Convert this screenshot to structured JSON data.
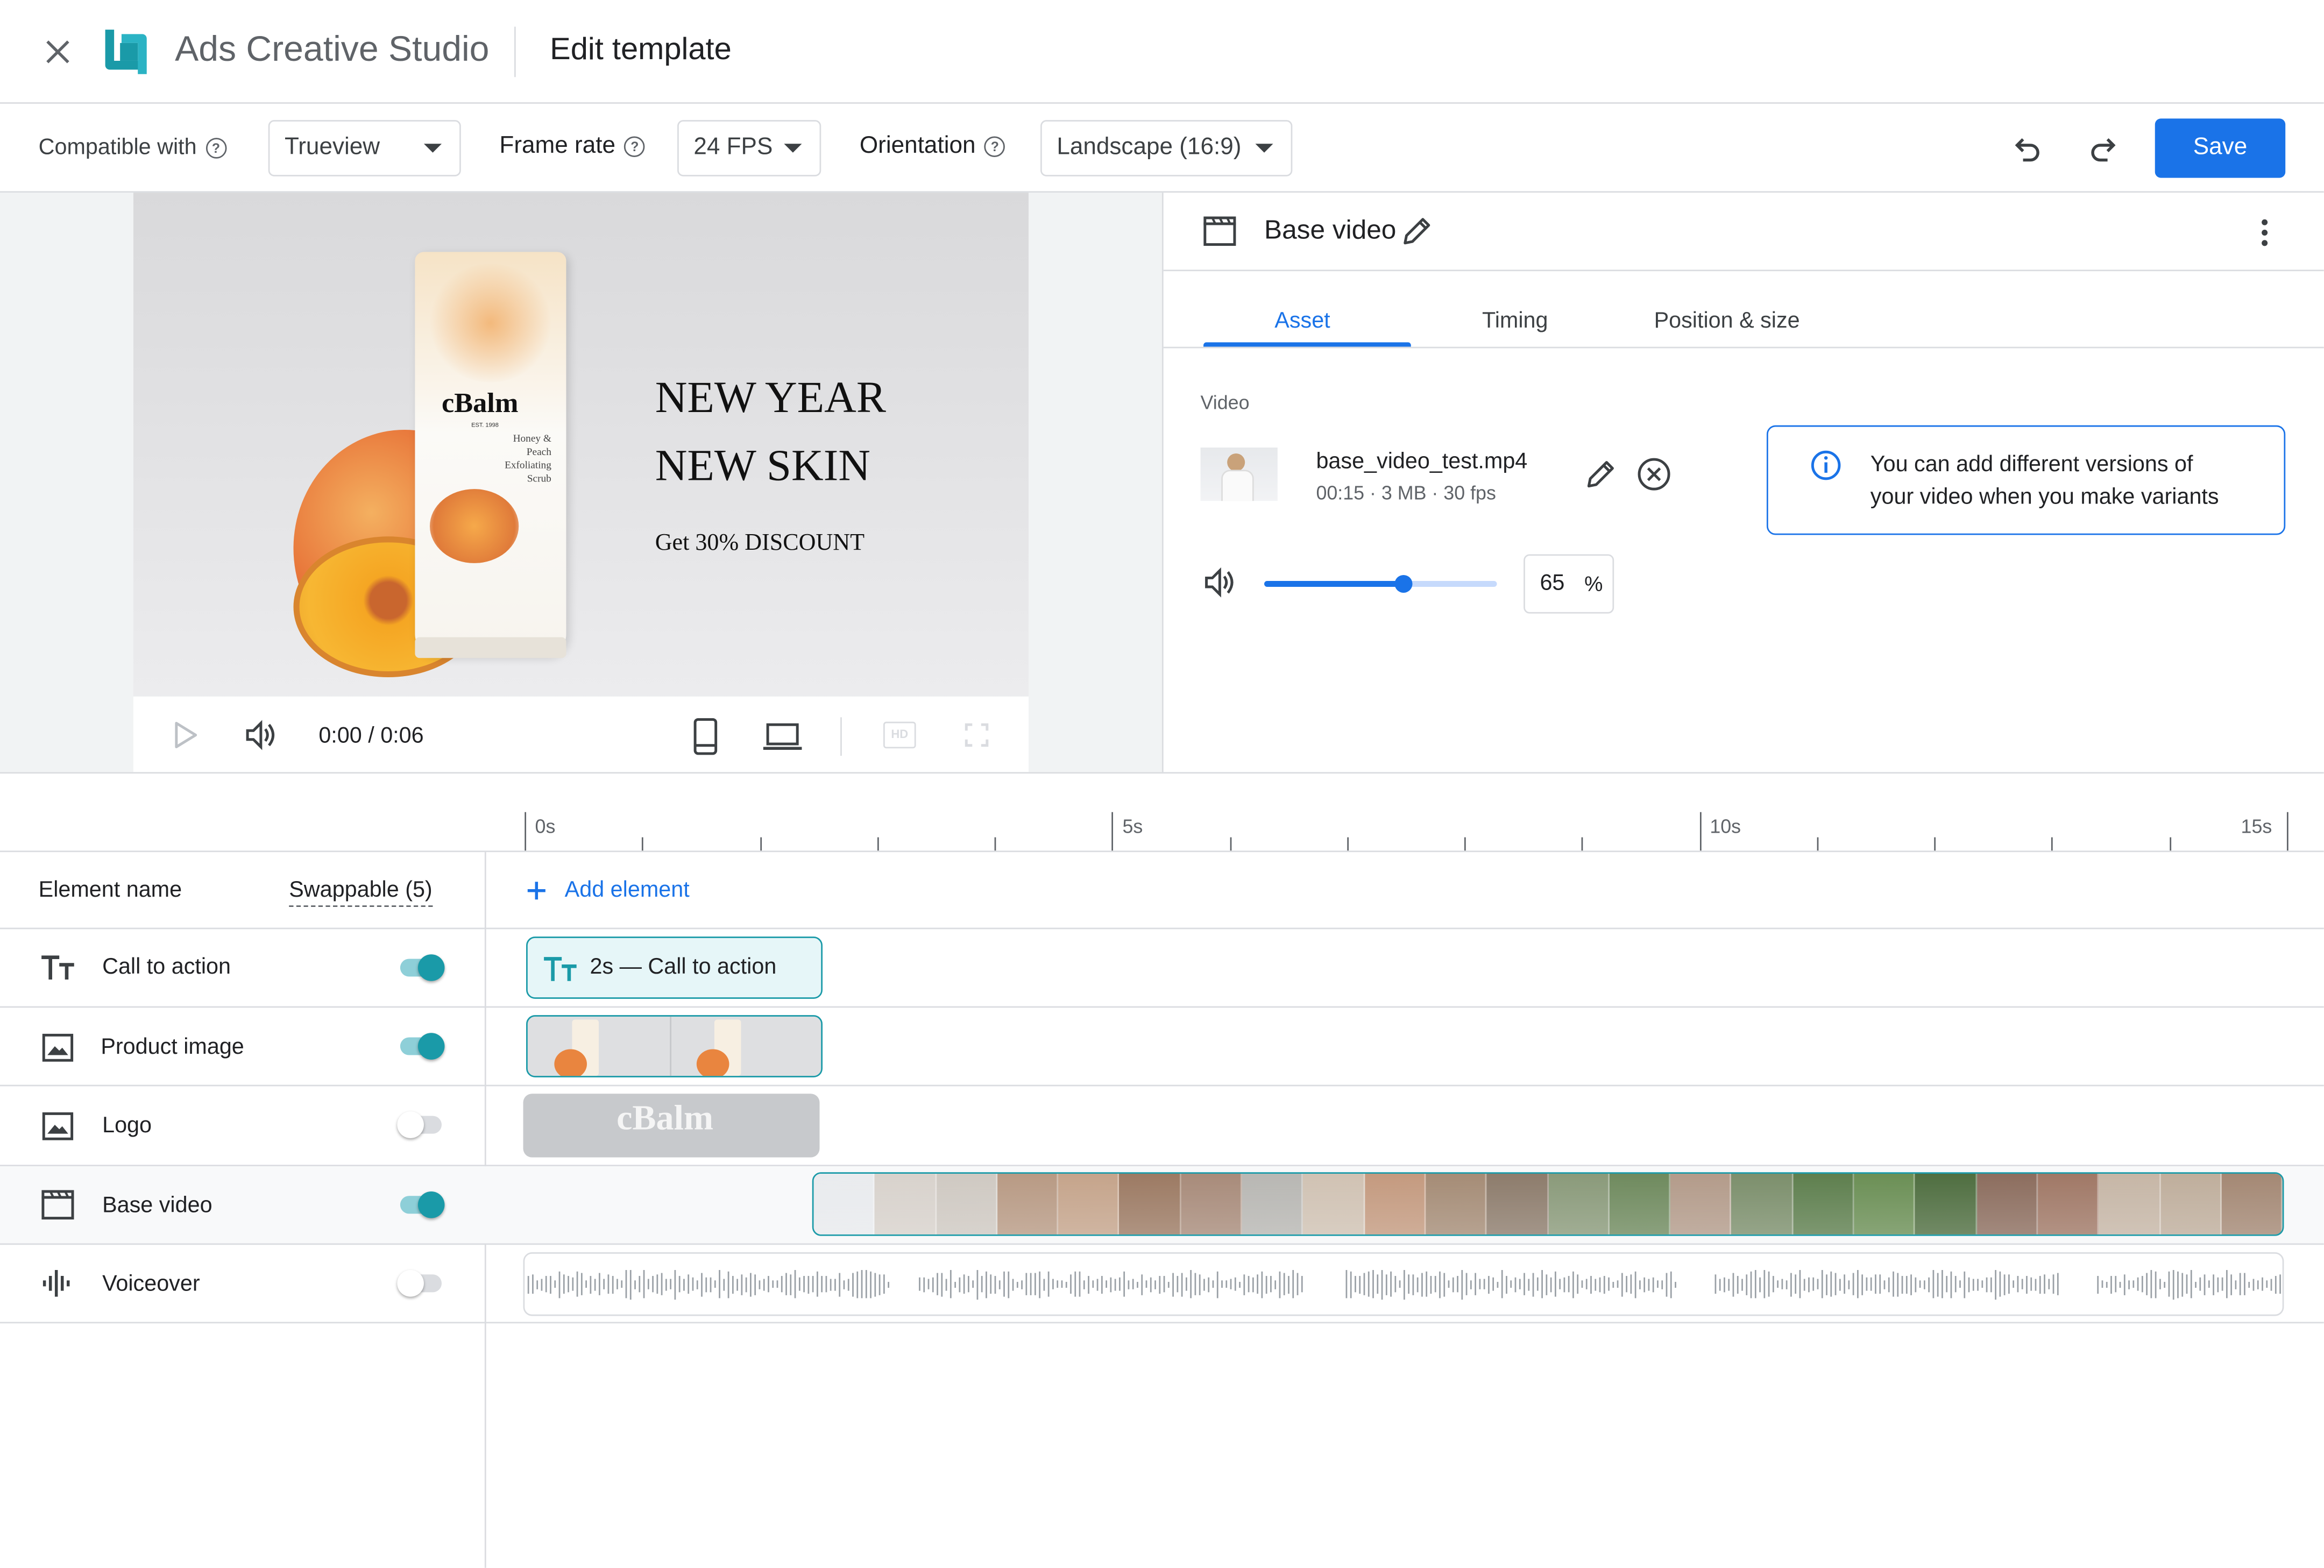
{
  "header": {
    "app_name": "Ads Creative Studio",
    "page_title": "Edit template",
    "save_label": "Save"
  },
  "toolbar": {
    "compatible_label": "Compatible with",
    "compatible_value": "Trueview",
    "framerate_label": "Frame rate",
    "framerate_value": "24 FPS",
    "orientation_label": "Orientation",
    "orientation_value": "Landscape (16:9)"
  },
  "preview": {
    "headline1": "NEW YEAR",
    "headline2": "NEW SKIN",
    "subline": "Get 30% DISCOUNT",
    "brand": "cBalm",
    "brand_est": "EST. 1998",
    "product_text": "Honey & Peach Exfoliating Scrub",
    "time": "0:00 / 0:06",
    "hd_label": "HD"
  },
  "panel": {
    "title": "Base video",
    "tabs": [
      "Asset",
      "Timing",
      "Position & size"
    ],
    "active_tab": "Asset",
    "section_label": "Video",
    "file_name": "base_video_test.mp4",
    "file_meta": "00:15 · 3 MB · 30 fps",
    "info_text_1": "You can add different versions of",
    "info_text_2": "your video when you make variants",
    "volume_value": "65",
    "volume_unit": "%",
    "volume_level": 0.6
  },
  "timeline": {
    "ticks": [
      "0s",
      "5s",
      "10s",
      "15s"
    ],
    "col_element_name": "Element name",
    "col_swappable": "Swappable (5)",
    "add_element": "Add element",
    "cta_clip_label": "2s — Call to action",
    "logo_clip_text": "cBalm",
    "rows": [
      {
        "name": "Call to action",
        "icon": "text-icon",
        "swappable": true
      },
      {
        "name": "Product image",
        "icon": "image-icon",
        "swappable": true
      },
      {
        "name": "Logo",
        "icon": "image-icon",
        "swappable": false
      },
      {
        "name": "Base video",
        "icon": "video-icon",
        "swappable": true
      },
      {
        "name": "Voiceover",
        "icon": "audio-icon",
        "swappable": false
      }
    ]
  },
  "colors": {
    "accent_blue": "#1a73e8",
    "teal": "#1a9aa8",
    "clip_fill": "#e6f6f8"
  }
}
